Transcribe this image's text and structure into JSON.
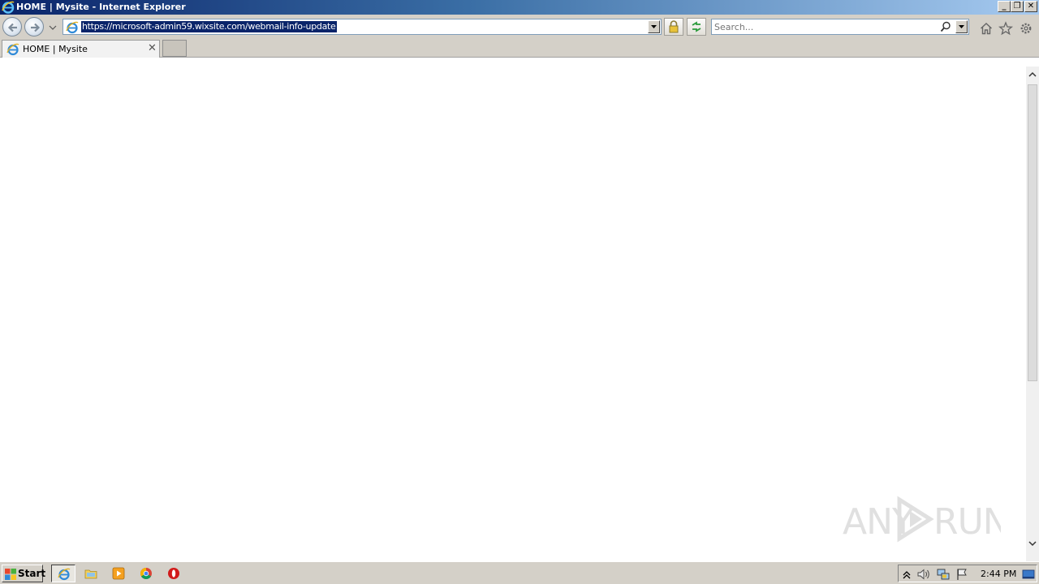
{
  "window": {
    "title": "HOME | Mysite - Internet Explorer",
    "minimize_icon": "minimize-icon",
    "restore_icon": "restore-icon",
    "close_icon": "close-icon"
  },
  "navigation": {
    "back_icon": "back-arrow-icon",
    "forward_icon": "forward-arrow-icon",
    "address_url": "https://microsoft-admin59.wixsite.com/webmail-info-update",
    "security_icon": "lock-icon",
    "refresh_icon": "compatibility-refresh-icon",
    "search_placeholder": "Search...",
    "home_icon": "home-icon",
    "favorites_icon": "star-icon",
    "tools_icon": "gear-icon"
  },
  "tabs": [
    {
      "label": "HOME | Mysite",
      "active": true
    }
  ],
  "content": {
    "watermark_text": "ANY RUN"
  },
  "taskbar": {
    "start_label": "Start",
    "quick_launch": [
      "internet-explorer-icon",
      "folder-icon",
      "media-player-icon",
      "chrome-icon",
      "opera-icon"
    ],
    "tray_icons": [
      "show-hidden-icons-icon",
      "volume-icon",
      "network-icon",
      "action-center-flag-icon"
    ],
    "clock": "2:44 PM"
  },
  "colors": {
    "titlebar_start": "#0a246a",
    "titlebar_end": "#a6caf0",
    "chrome_gray": "#d4d0c8",
    "url_selection": "#0a246a"
  }
}
